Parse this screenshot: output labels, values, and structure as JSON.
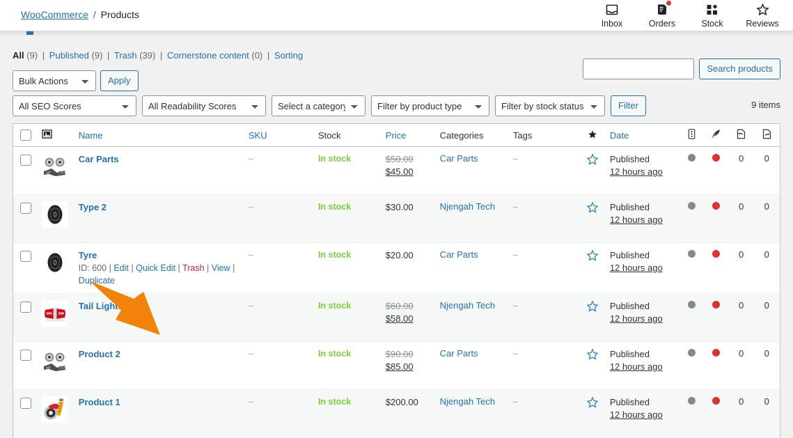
{
  "header": {
    "breadcrumb": {
      "root": "WooCommerce",
      "separator": "/",
      "current": "Products"
    },
    "activity_panel": [
      {
        "label": "Inbox",
        "icon": "inbox-icon",
        "badge": false
      },
      {
        "label": "Orders",
        "icon": "orders-icon",
        "badge": true
      },
      {
        "label": "Stock",
        "icon": "stock-icon",
        "badge": false
      },
      {
        "label": "Reviews",
        "icon": "reviews-star-icon",
        "badge": false
      }
    ]
  },
  "views": {
    "all": {
      "label": "All",
      "count": "(9)"
    },
    "published": {
      "label": "Published",
      "count": "(9)"
    },
    "trash": {
      "label": "Trash",
      "count": "(39)"
    },
    "cornerstone": {
      "label": "Cornerstone content",
      "count": "(0)"
    },
    "sorting": {
      "label": "Sorting"
    },
    "divider": "|"
  },
  "search": {
    "value": "",
    "placeholder": "",
    "button_label": "Search products"
  },
  "toolbar": {
    "bulk_actions_selected": "Bulk Actions",
    "apply_label": "Apply",
    "seo_scores_selected": "All SEO Scores",
    "readability_selected": "All Readability Scores",
    "category_selected": "Select a category",
    "product_type_selected": "Filter by product type",
    "stock_status_selected": "Filter by stock status",
    "filter_label": "Filter",
    "items_count": "9 items"
  },
  "table": {
    "columns": {
      "checkbox": "",
      "thumbnail_icon": "image-icon",
      "name": "Name",
      "sku": "SKU",
      "stock": "Stock",
      "price": "Price",
      "categories": "Categories",
      "tags": "Tags",
      "featured_icon": "star-filled-icon",
      "date": "Date",
      "seo_score_icon": "seo-score-icon",
      "readability_icon": "readability-feather-icon",
      "inbound_links_icon": "inbound-links-icon",
      "outbound_links_icon": "outbound-links-icon"
    },
    "rows": [
      {
        "name": "Car Parts",
        "thumb": "brake-discs",
        "sku": "–",
        "stock": "In stock",
        "price": {
          "regular": "$50.00",
          "sale": "$45.00"
        },
        "categories": "Car Parts",
        "tags": "–",
        "featured": "star-outline-icon",
        "date_status": "Published",
        "date_ago": "12 hours ago",
        "seo_dot": "grey",
        "read_dot": "red",
        "inbound": "0",
        "outbound": "0",
        "actions_visible": false,
        "alt": false
      },
      {
        "name": "Type 2",
        "thumb": "tyre",
        "sku": "–",
        "stock": "In stock",
        "price": {
          "single": "$30.00"
        },
        "categories": "Njengah Tech",
        "tags": "–",
        "featured": "star-outline-icon",
        "date_status": "Published",
        "date_ago": "12 hours ago",
        "seo_dot": "grey",
        "read_dot": "red",
        "inbound": "0",
        "outbound": "0",
        "actions_visible": false,
        "alt": true
      },
      {
        "name": "Tyre",
        "thumb": "tyre",
        "sku": "–",
        "stock": "In stock",
        "price": {
          "single": "$20.00"
        },
        "categories": "Car Parts",
        "tags": "–",
        "featured": "star-outline-icon",
        "date_status": "Published",
        "date_ago": "12 hours ago",
        "seo_dot": "grey",
        "read_dot": "red",
        "inbound": "0",
        "outbound": "0",
        "actions_visible": true,
        "actions": {
          "id": "ID: 600",
          "edit": "Edit",
          "quick_edit": "Quick Edit",
          "trash": "Trash",
          "view": "View",
          "duplicate": "Duplicate",
          "sep": "|"
        },
        "alt": false
      },
      {
        "name": "Tail Lights",
        "thumb": "tail-lights",
        "sku": "–",
        "stock": "In stock",
        "price": {
          "regular": "$60.00",
          "sale": "$58.00"
        },
        "categories": "Njengah Tech",
        "tags": "–",
        "featured": "star-outline-icon",
        "date_status": "Published",
        "date_ago": "12 hours ago",
        "seo_dot": "grey",
        "read_dot": "red",
        "inbound": "0",
        "outbound": "0",
        "actions_visible": false,
        "alt": true
      },
      {
        "name": "Product 2",
        "thumb": "brake-discs",
        "sku": "–",
        "stock": "In stock",
        "price": {
          "regular": "$90.00",
          "sale": "$85.00"
        },
        "categories": "Car Parts",
        "tags": "–",
        "featured": "star-outline-icon",
        "date_status": "Published",
        "date_ago": "12 hours ago",
        "seo_dot": "grey",
        "read_dot": "red",
        "inbound": "0",
        "outbound": "0",
        "actions_visible": false,
        "alt": false
      },
      {
        "name": "Product 1",
        "thumb": "suspension",
        "sku": "–",
        "stock": "In stock",
        "price": {
          "single": "$200.00"
        },
        "categories": "Njengah Tech",
        "tags": "–",
        "featured": "star-outline-icon",
        "date_status": "Published",
        "date_ago": "12 hours ago",
        "seo_dot": "grey",
        "read_dot": "red",
        "inbound": "0",
        "outbound": "0",
        "actions_visible": false,
        "alt": true
      }
    ]
  },
  "colors": {
    "link": "#2271b1",
    "in_stock": "#7ad03a",
    "trash": "#b32d2e",
    "badge_red": "#d63638",
    "cursor_orange": "#f2820a",
    "seo_grey": "#888888",
    "read_red": "#dc3232"
  }
}
